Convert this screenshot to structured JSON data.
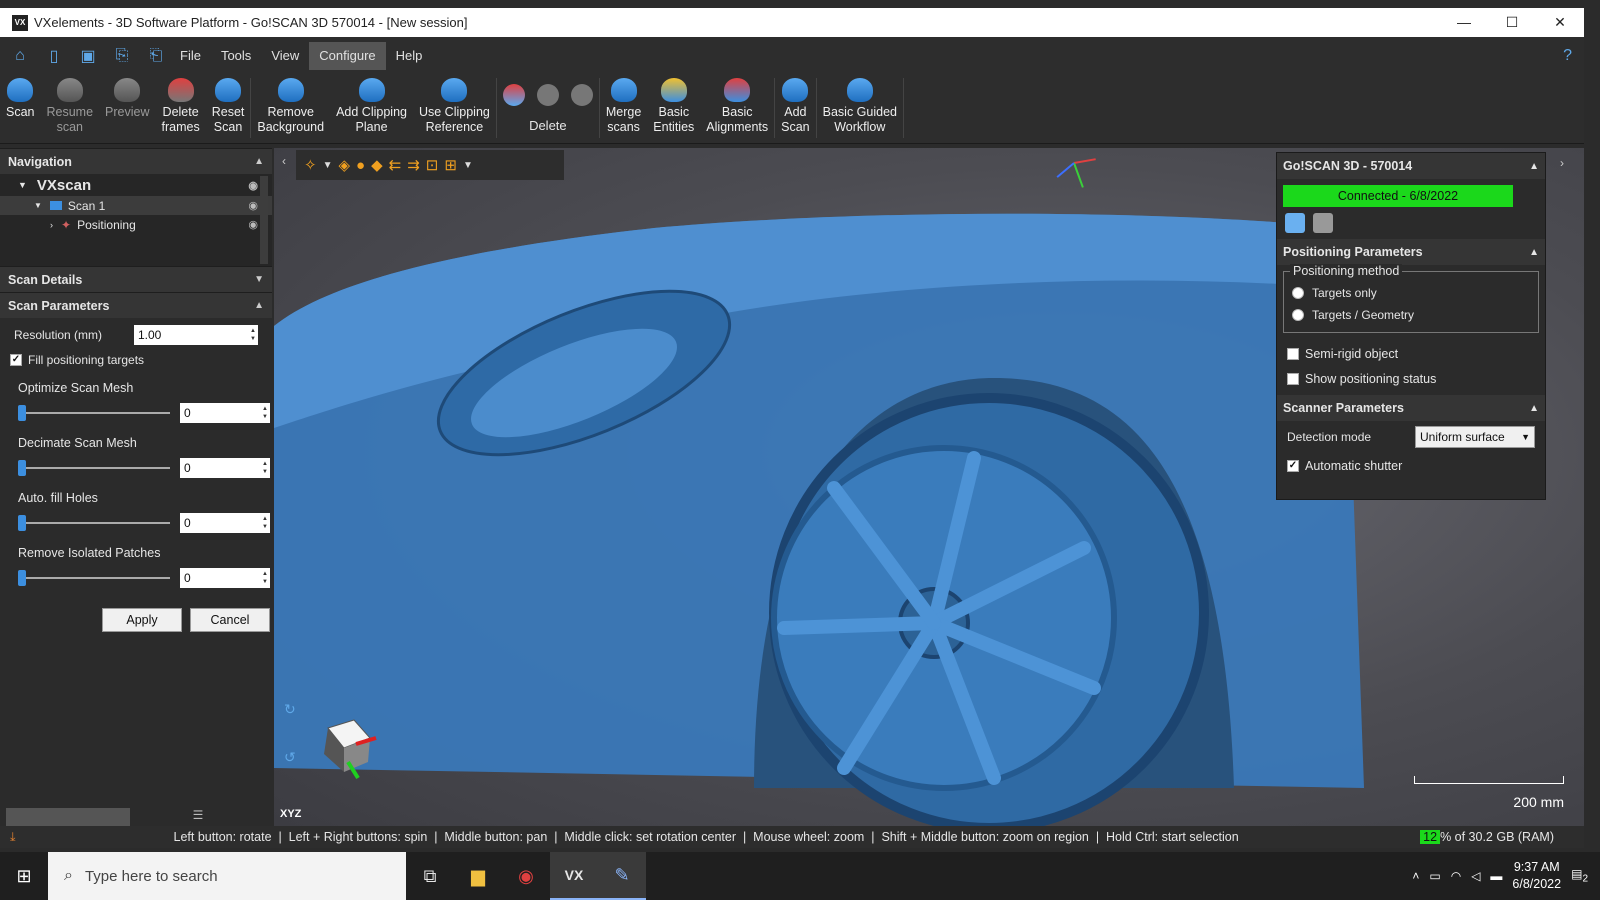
{
  "window": {
    "title": "VXelements - 3D Software Platform - Go!SCAN 3D 570014 - [New session]",
    "logo_text": "VX"
  },
  "menu": {
    "items": [
      "File",
      "Tools",
      "View",
      "Configure",
      "Help"
    ],
    "active": "Configure"
  },
  "ribbon": {
    "scan": "Scan",
    "resume": "Resume\nscan",
    "preview": "Preview",
    "delete_frames": "Delete\nframes",
    "reset_scan": "Reset\nScan",
    "remove_background": "Remove\nBackground",
    "add_clipping": "Add Clipping\nPlane",
    "use_clipping": "Use Clipping\nReference",
    "delete": "Delete",
    "merge": "Merge\nscans",
    "basic_entities": "Basic\nEntities",
    "basic_alignments": "Basic\nAlignments",
    "add_scan": "Add\nScan",
    "guided": "Basic Guided\nWorkflow"
  },
  "navigation": {
    "title": "Navigation",
    "tree": {
      "root": "VXscan",
      "scan": "Scan 1",
      "positioning": "Positioning"
    }
  },
  "scan_details": {
    "title": "Scan Details"
  },
  "scan_parameters": {
    "title": "Scan Parameters",
    "resolution_label": "Resolution (mm)",
    "resolution_value": "1.00",
    "fill_targets_label": "Fill positioning targets",
    "optimize_label": "Optimize Scan Mesh",
    "optimize_value": "0",
    "decimate_label": "Decimate Scan Mesh",
    "decimate_value": "0",
    "fill_holes_label": "Auto. fill Holes",
    "fill_holes_value": "0",
    "remove_patches_label": "Remove Isolated Patches",
    "remove_patches_value": "0",
    "apply": "Apply",
    "cancel": "Cancel"
  },
  "viewport": {
    "scale_label": "200 mm",
    "axes_label": "XYZ"
  },
  "device_panel": {
    "title": "Go!SCAN 3D - 570014",
    "status": "Connected - 6/8/2022",
    "status_color": "#1bd81b",
    "positioning": {
      "title": "Positioning Parameters",
      "method_label": "Positioning method",
      "options": [
        "Targets only",
        "Targets / Geometry"
      ],
      "semi_rigid": "Semi-rigid object",
      "show_status": "Show positioning status"
    },
    "scanner": {
      "title": "Scanner Parameters",
      "detection_label": "Detection mode",
      "detection_value": "Uniform surface",
      "auto_shutter": "Automatic shutter"
    }
  },
  "status_bar": {
    "hint": "Left button: rotate  |  Left + Right buttons: spin  |  Middle button: pan  |  Middle click: set rotation center  |  Mouse wheel: zoom  |  Shift + Middle button: zoom on region  |  Hold Ctrl: start selection",
    "mem_percent": "12",
    "mem_rest": "% of 30.2 GB (RAM)"
  },
  "taskbar": {
    "search_placeholder": "Type here to search",
    "time": "9:37 AM",
    "date": "6/8/2022",
    "notif_count": "2"
  }
}
